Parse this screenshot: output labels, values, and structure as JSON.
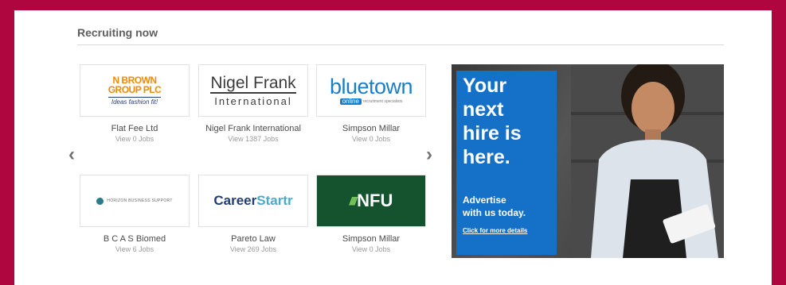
{
  "section": {
    "title": "Recruiting now"
  },
  "carousel": {
    "prev_icon": "chevron-left-icon",
    "next_icon": "chevron-right-icon",
    "prev_glyph": "‹",
    "next_glyph": "›",
    "cards": [
      {
        "name": "Flat Fee Ltd",
        "jobs": "View 0 Jobs",
        "logo": {
          "line1": "N BROWN",
          "line2": "GROUP PLC",
          "line3": "Ideas fashion fit!"
        }
      },
      {
        "name": "Nigel Frank International",
        "jobs": "View 1387 Jobs",
        "logo": {
          "line1": "Nigel Frank",
          "line2": "International"
        }
      },
      {
        "name": "Simpson Millar",
        "jobs": "View 0 Jobs",
        "logo": {
          "line1": "bluetown",
          "tag": "online",
          "tiny": "recruitment specialists"
        }
      },
      {
        "name": "B C A S Biomed",
        "jobs": "View 6 Jobs",
        "logo": {
          "line1": "HORIZON BUSINESS SUPPORT"
        }
      },
      {
        "name": "Pareto Law",
        "jobs": "View 269 Jobs",
        "logo": {
          "part1": "Career",
          "part2": "Startr"
        }
      },
      {
        "name": "Simpson Millar",
        "jobs": "View 0 Jobs",
        "logo": {
          "mark": "////",
          "line1": "NFU"
        }
      }
    ]
  },
  "advert": {
    "headline": "Your\nnext\nhire is\nhere.",
    "sub": "Advertise\nwith us today.",
    "cta": "Click for more details",
    "colors": {
      "panel": "#1570c7"
    }
  },
  "colors": {
    "brand_border": "#b0063f",
    "title": "#5e5e5e"
  }
}
